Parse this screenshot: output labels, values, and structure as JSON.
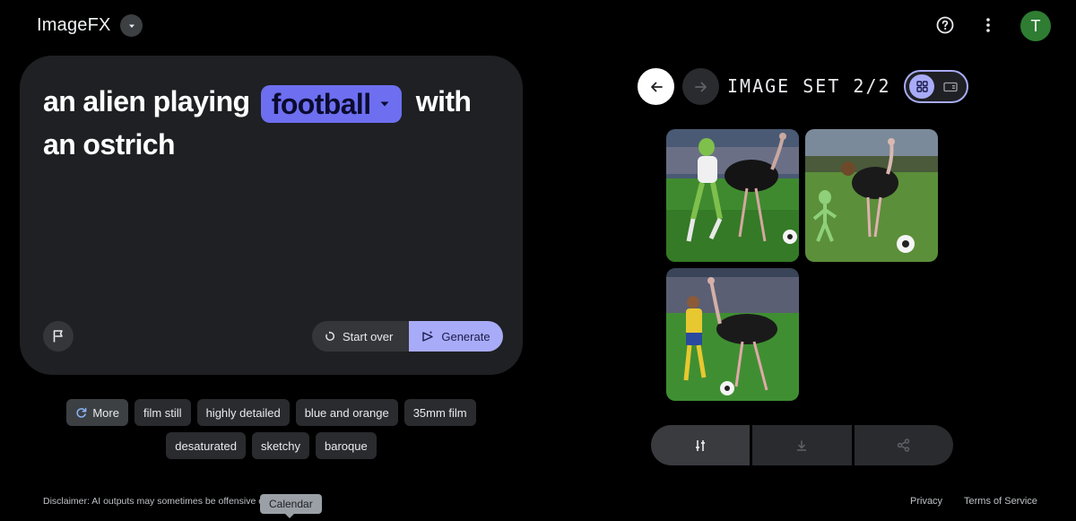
{
  "header": {
    "brand": "ImageFX",
    "avatar_initial": "T"
  },
  "prompt": {
    "before": "an alien playing",
    "chip": "football",
    "after": "with an ostrich"
  },
  "actions": {
    "start_over": "Start over",
    "generate": "Generate"
  },
  "chips": {
    "more": "More",
    "row1": [
      "film still",
      "highly detailed",
      "blue and orange",
      "35mm film"
    ],
    "row2": [
      "desaturated",
      "sketchy",
      "baroque"
    ]
  },
  "footer": {
    "disclaimer": "Disclaimer: AI outputs may sometimes be offensive o",
    "tooltip": "Calendar",
    "privacy": "Privacy",
    "terms": "Terms of Service"
  },
  "results": {
    "set_label": "IMAGE SET 2/2",
    "images": [
      "alien-ostrich-football-image-1",
      "alien-ostrich-football-image-2",
      "player-ostrich-football-image-3"
    ]
  },
  "colors": {
    "accent": "#a8abf7",
    "chip_word": "#6d6ff0",
    "card": "#1f2023",
    "avatar": "#2e7d32"
  }
}
